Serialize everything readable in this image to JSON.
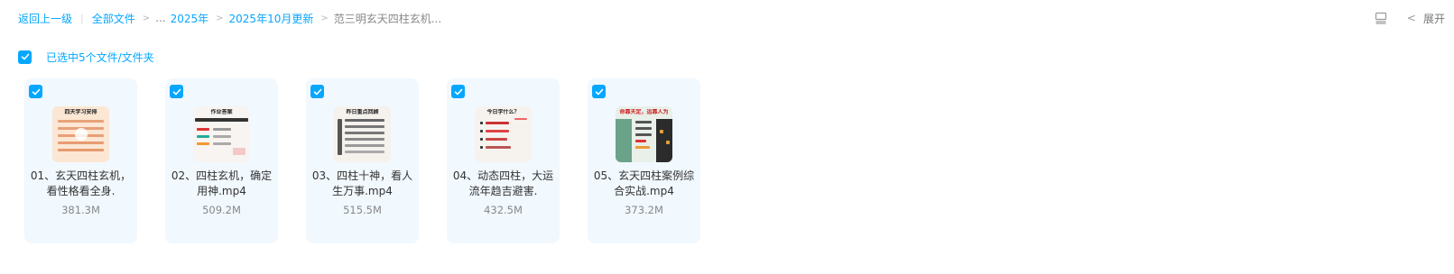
{
  "breadcrumb": {
    "back_label": "返回上一级",
    "all_files_label": "全部文件",
    "ellipsis": "...",
    "level1": "2025年",
    "level2": "2025年10月更新",
    "current": "范三明玄天四柱玄机..."
  },
  "toolbar": {
    "expand_label": "展开"
  },
  "selection": {
    "summary": "已选中5个文件/文件夹"
  },
  "files": [
    {
      "name": "01、玄天四柱玄机，看性格看全身.",
      "size": "381.3M",
      "thumb_title": "四天学习安排"
    },
    {
      "name": "02、四柱玄机，确定用神.mp4",
      "size": "509.2M",
      "thumb_title": "作业答案"
    },
    {
      "name": "03、四柱十神，看人生万事.mp4",
      "size": "515.5M",
      "thumb_title": "昨日重点回顾"
    },
    {
      "name": "04、动态四柱，大运流年趋吉避害.",
      "size": "432.5M",
      "thumb_title": "今日学什么？"
    },
    {
      "name": "05、玄天四柱案例综合实战.mp4",
      "size": "373.2M",
      "thumb_title": "命靠天定，运靠人为"
    }
  ],
  "colors": {
    "accent": "#06a7ff",
    "card_bg": "#f1f8fe"
  }
}
